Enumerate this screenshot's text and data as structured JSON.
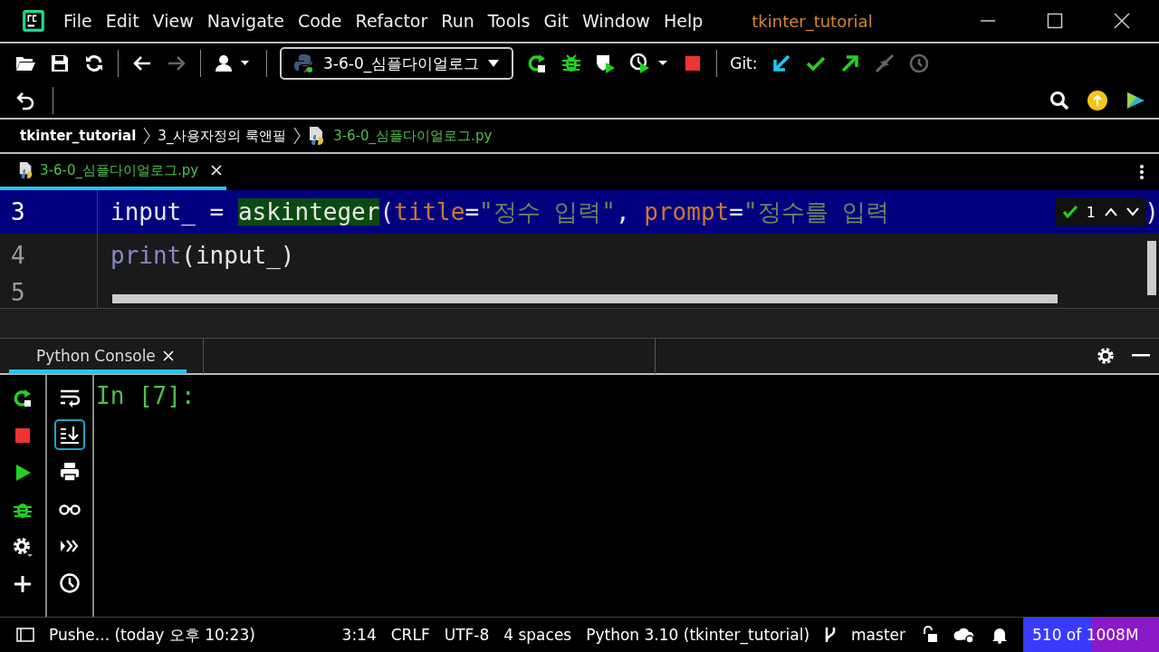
{
  "window": {
    "title": "tkinter_tutorial"
  },
  "menu": [
    "File",
    "Edit",
    "View",
    "Navigate",
    "Code",
    "Refactor",
    "Run",
    "Tools",
    "Git",
    "Window",
    "Help"
  ],
  "toolbar": [
    {
      "kind": "open",
      "disabled": false
    },
    {
      "kind": "save",
      "disabled": false
    },
    {
      "kind": "sync",
      "disabled": false
    },
    {
      "kind": "sep"
    },
    {
      "kind": "back",
      "disabled": false
    },
    {
      "kind": "forward",
      "disabled": true
    },
    {
      "kind": "sep"
    },
    {
      "kind": "user",
      "disabled": false
    },
    {
      "kind": "sep"
    },
    {
      "kind": "config"
    },
    {
      "kind": "rerun",
      "disabled": false
    },
    {
      "kind": "debug",
      "disabled": false
    },
    {
      "kind": "coverage",
      "disabled": false
    },
    {
      "kind": "profile",
      "disabled": false
    },
    {
      "kind": "stop",
      "disabled": false
    },
    {
      "kind": "sep"
    },
    {
      "kind": "git"
    },
    {
      "kind": "update",
      "disabled": false
    },
    {
      "kind": "commit",
      "disabled": false
    },
    {
      "kind": "push",
      "disabled": false
    },
    {
      "kind": "merge",
      "disabled": true
    },
    {
      "kind": "history",
      "disabled": true
    }
  ],
  "run_config": "3-6-0_심플다이얼로그",
  "git_label": "Git:",
  "breadcrumbs": [
    {
      "label": "tkinter_tutorial",
      "kind": "project"
    },
    {
      "label": "3_사용자정의 룩앤필",
      "kind": "folder"
    },
    {
      "label": "3-6-0_심플다이얼로그.py",
      "kind": "file"
    }
  ],
  "editor_tabs": [
    {
      "label": "3-6-0_심플다이얼로그.py",
      "selected": true
    }
  ],
  "code_lines": [
    {
      "number": "3",
      "selected": true,
      "tokens": [
        {
          "text": "input_ = ",
          "kind": "plain"
        },
        {
          "text": "askinteger",
          "kind": "match"
        },
        {
          "text": "(",
          "kind": "plain"
        },
        {
          "text": "title",
          "kind": "param"
        },
        {
          "text": "=",
          "kind": "plain"
        },
        {
          "text": "\"정수 입력\"",
          "kind": "string"
        },
        {
          "text": ", ",
          "kind": "plain"
        },
        {
          "text": "prompt",
          "kind": "param"
        },
        {
          "text": "=",
          "kind": "plain"
        },
        {
          "text": "\"정수를 입력",
          "kind": "string"
        }
      ],
      "tail": ")"
    },
    {
      "number": "4",
      "selected": false,
      "tokens": [
        {
          "text": "print",
          "kind": "builtin"
        },
        {
          "text": "(input_)",
          "kind": "plain"
        }
      ]
    },
    {
      "number": "5",
      "selected": false
    }
  ],
  "find_popup": {
    "count": "1"
  },
  "console": {
    "tab": "Python Console",
    "prompt": "In [7]:"
  },
  "console_tools_left": [
    {
      "kind": "rerun"
    },
    {
      "kind": "stop"
    },
    {
      "kind": "run"
    },
    {
      "kind": "debug"
    },
    {
      "kind": "settings"
    },
    {
      "kind": "add"
    }
  ],
  "console_tools_right": [
    {
      "kind": "wrap",
      "selected": false
    },
    {
      "kind": "scroll-end",
      "selected": true
    },
    {
      "kind": "print",
      "selected": false
    },
    {
      "kind": "glasses",
      "selected": false
    },
    {
      "kind": "execute",
      "selected": false
    },
    {
      "kind": "history",
      "selected": false
    }
  ],
  "status_bar": {
    "message": "Pushe... (today 오후 10:23)",
    "items": [
      "3:14",
      "CRLF",
      "UTF-8",
      "4 spaces",
      "Python 3.10 (tkinter_tutorial)"
    ],
    "branch": "master",
    "memory": {
      "text": "510 of 1008M",
      "level": 0.5
    }
  }
}
